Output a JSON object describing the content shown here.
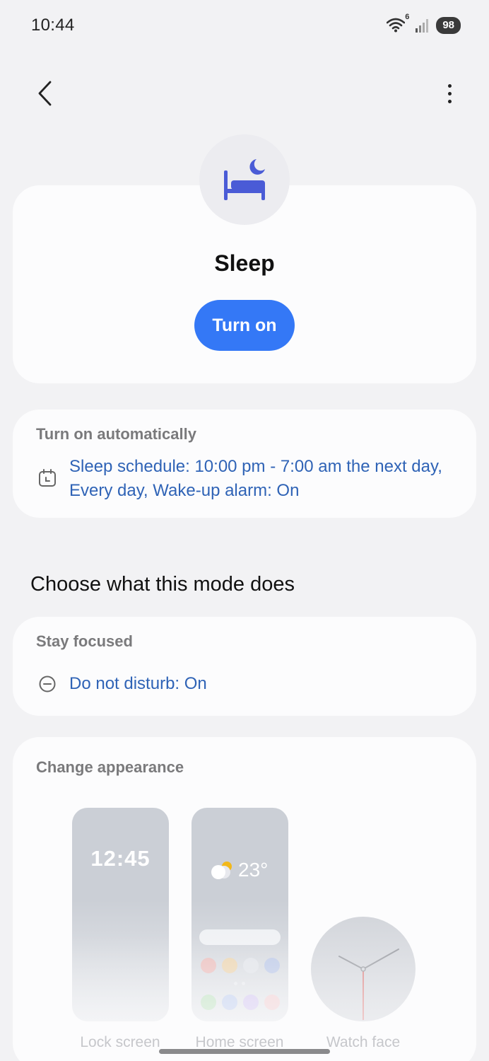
{
  "status_bar": {
    "time": "10:44",
    "wifi_badge": "6",
    "battery": "98"
  },
  "mode": {
    "icon": "bed-moon-icon",
    "title": "Sleep",
    "turn_on_label": "Turn on"
  },
  "auto": {
    "label": "Turn on automatically",
    "icon": "calendar-icon",
    "schedule": "Sleep schedule: 10:00 pm - 7:00 am the next day, Every day, Wake-up alarm: On"
  },
  "section_heading": "Choose what this mode does",
  "focus": {
    "label": "Stay focused",
    "icon": "minus-circle-icon",
    "dnd": "Do not disturb: On"
  },
  "appearance": {
    "label": "Change appearance",
    "lock_time": "12:45",
    "home_temp": "23°",
    "lock_label": "Lock screen",
    "home_label": "Home screen",
    "watch_label": "Watch face"
  },
  "colors": {
    "accent": "#3478f6",
    "link": "#2f63b6",
    "icon_blue": "#4a5bd6"
  }
}
